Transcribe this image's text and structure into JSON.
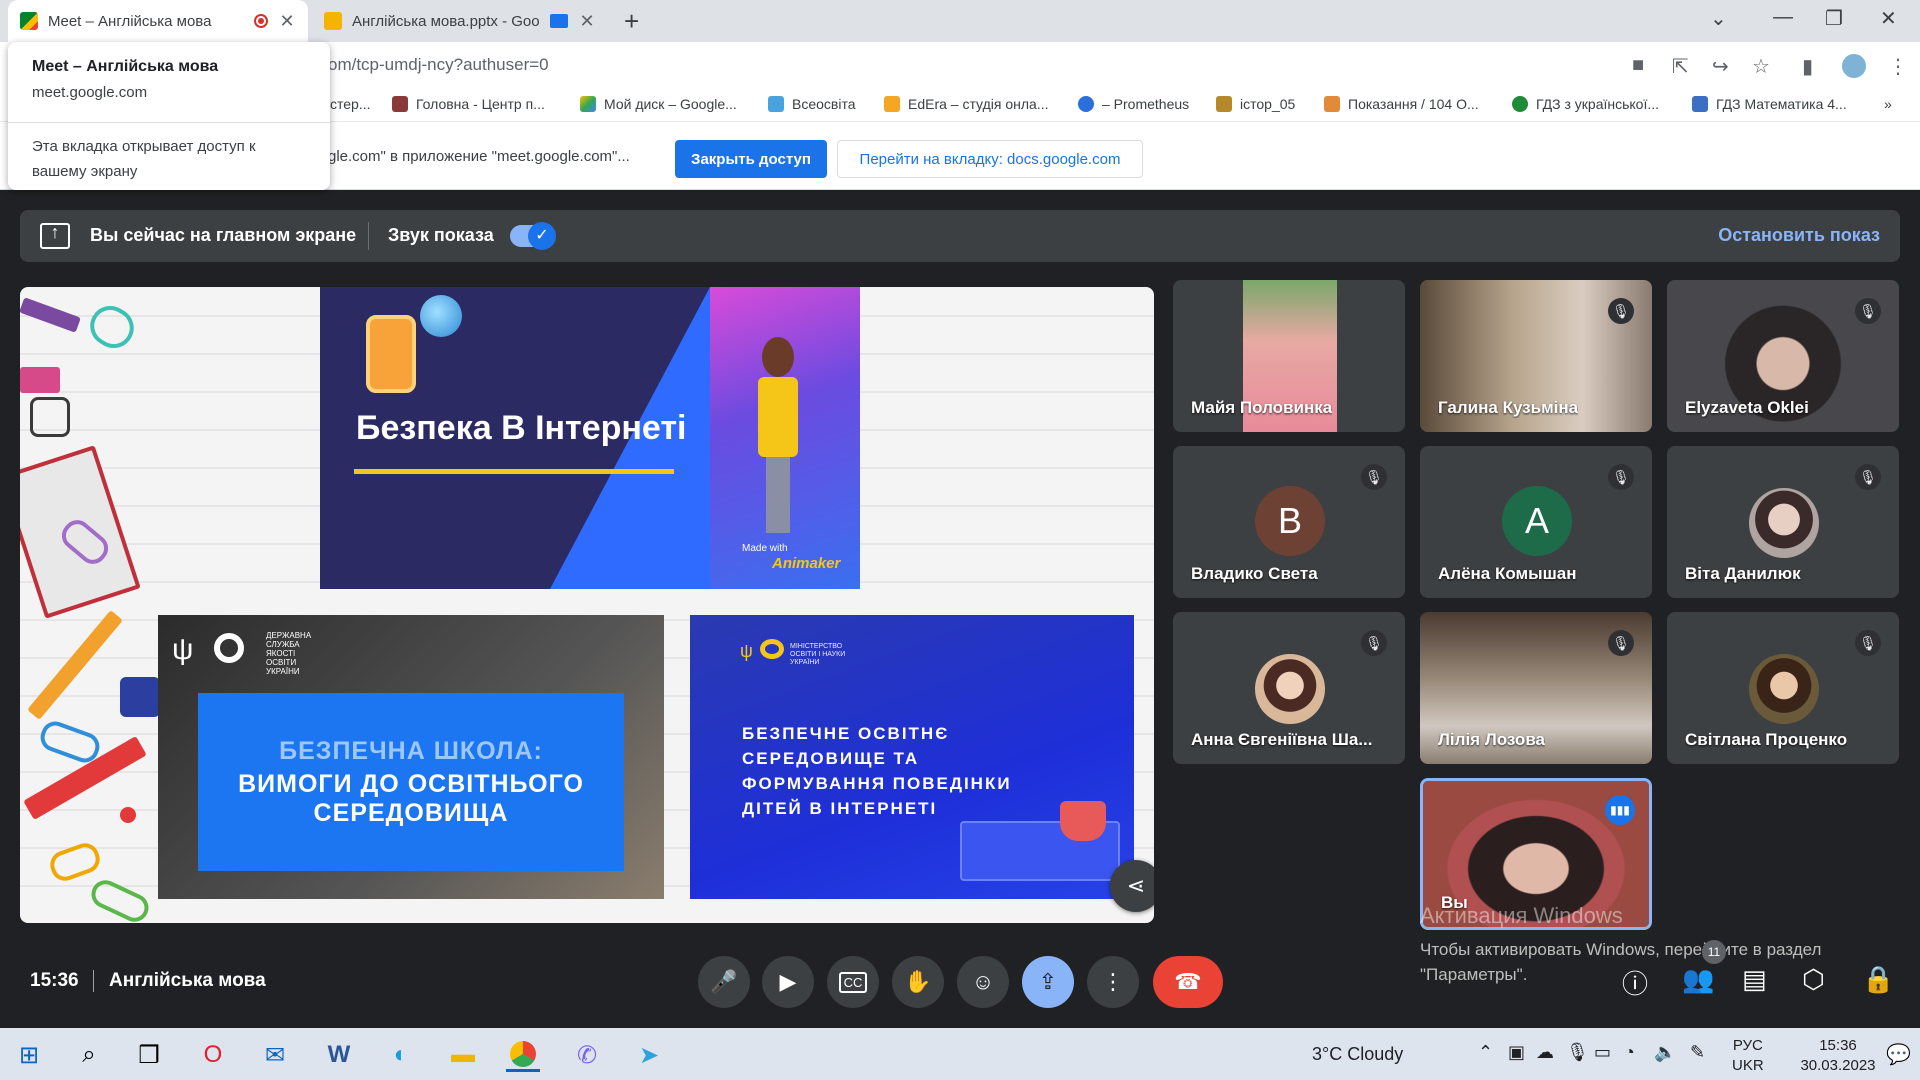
{
  "browser": {
    "tabs": [
      {
        "title": "Meet – Англійська мова",
        "active": true
      },
      {
        "title": "Англійська мова.pptx - Goo",
        "active": false
      }
    ],
    "new_tab": "+",
    "url": "om/tcp-umdj-ncy?authuser=0",
    "bookmarks": [
      "стер...",
      "Головна - Центр п...",
      "Мой диск – Google...",
      "Всеосвіта",
      "EdEra – студія онла...",
      "– Prometheus",
      "істор_05",
      "Показання / 104 О...",
      "ГДЗ з української...",
      "ГДЗ Математика 4...",
      "»"
    ],
    "share_notice": {
      "text": "gle.com\" в приложение \"meet.google.com\"...",
      "stop_button": "Закрыть доступ",
      "switch_button": "Перейти на вкладку: docs.google.com"
    },
    "tab_popup": {
      "title": "Meet – Англійська мова",
      "url": "meet.google.com",
      "message": "Эта вкладка открывает доступ к вашему экрану"
    }
  },
  "meet": {
    "presenting_bar": {
      "label": "Вы сейчас на главном экране",
      "audio_label": "Звук показа",
      "audio_on": true,
      "stop_label": "Остановить показ"
    },
    "slide": {
      "title": "Безпека В Інтернеті",
      "made_with": "Made with",
      "brand": "Animaker",
      "card2_org": "ДЕРЖАВНА\nСЛУЖБА\nЯКОСТІ ОСВІТИ\nУКРАЇНИ",
      "card2_line1": "БЕЗПЕЧНА ШКОЛА:",
      "card2_line2": "ВИМОГИ ДО ОСВІТНЬОГО\nСЕРЕДОВИЩА",
      "card3_org": "МІНІСТЕРСТВО\nОСВІТИ І НАУКИ\nУКРАЇНИ",
      "card3_text": "БЕЗПЕЧНЕ ОСВІТНЄ\nСЕРЕДОВИЩЕ ТА\nФОРМУВАННЯ ПОВЕДІНКИ\nДІТЕЙ В ІНТЕРНЕТІ"
    },
    "participants": [
      {
        "name": "Майя Половинка",
        "muted": false,
        "kind": "video",
        "color": "#d98a8a"
      },
      {
        "name": "Галина Кузьміна",
        "muted": true,
        "kind": "video",
        "color": "#8a7a6a"
      },
      {
        "name": "Elyzaveta Oklei",
        "muted": true,
        "kind": "video",
        "color": "#4a4a4f"
      },
      {
        "name": "Владико Света",
        "muted": true,
        "kind": "letter",
        "letter": "В",
        "color": "#6d4234"
      },
      {
        "name": "Алёна Комышан",
        "muted": true,
        "kind": "letter",
        "letter": "A",
        "color": "#1e6b4a"
      },
      {
        "name": "Віта Данилюк",
        "muted": true,
        "kind": "photo",
        "color": "#b8a4a0"
      },
      {
        "name": "Анна Євгеніївна Ша...",
        "muted": true,
        "kind": "photo",
        "color": "#c9a48a"
      },
      {
        "name": "Лілія Лозова",
        "muted": true,
        "kind": "video",
        "color": "#8a7d70"
      },
      {
        "name": "Світлана Проценко",
        "muted": true,
        "kind": "photo",
        "color": "#9a8060"
      },
      {
        "name": "Вы",
        "muted": false,
        "kind": "self",
        "color": "#b04a4a"
      }
    ],
    "bottom": {
      "time": "15:36",
      "meeting_name": "Англійська мова",
      "participant_count": "11"
    }
  },
  "windows": {
    "activation_title": "Активация Windows",
    "activation_text": "Чтобы активировать Windows, перейдите в раздел\n\"Параметры\".",
    "weather": "3°C  Cloudy",
    "lang_top": "РУС",
    "lang_bottom": "UKR",
    "clock_time": "15:36",
    "clock_date": "30.03.2023"
  }
}
